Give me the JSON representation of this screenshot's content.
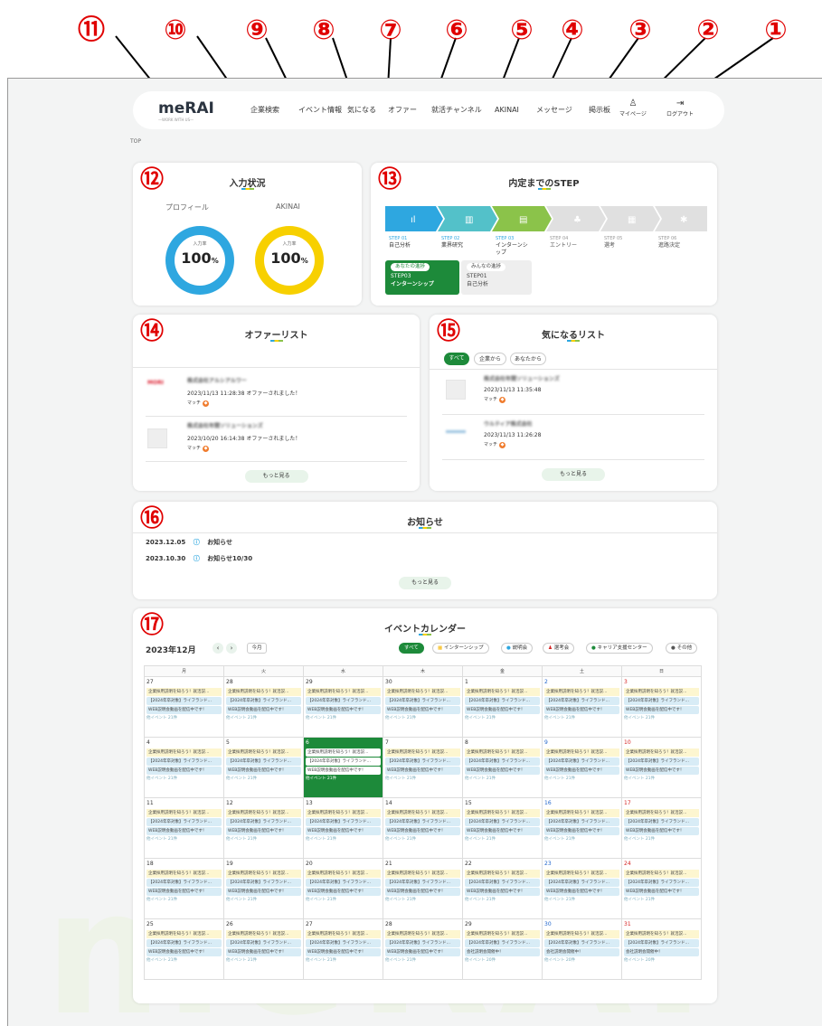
{
  "annotations": [
    "⑪",
    "⑩",
    "⑨",
    "⑧",
    "⑦",
    "⑥",
    "⑤",
    "④",
    "③",
    "②",
    "①",
    "⑫",
    "⑬",
    "⑭",
    "⑮",
    "⑯",
    "⑰"
  ],
  "header": {
    "logo": "meRAI",
    "logo_sub": "—WORK WITH US—",
    "nav": [
      "企業検索",
      "イベント情報",
      "気になる",
      "オファー",
      "就活チャンネル",
      "AKINAI",
      "メッセージ",
      "掲示板"
    ],
    "mypage": "マイページ",
    "logout": "ログアウト"
  },
  "breadcrumb": "TOP",
  "input_status": {
    "title": "入力状況",
    "items": [
      {
        "label": "プロフィール",
        "rate_label": "入力率",
        "value": "100",
        "unit": "%",
        "color": "#2ea7e0",
        "percent": 100
      },
      {
        "label": "AKINAI",
        "rate_label": "入力率",
        "value": "100",
        "unit": "%",
        "color": "#f7d000",
        "percent": 100
      }
    ]
  },
  "steps": {
    "title": "内定までのSTEP",
    "items": [
      {
        "no": "STEP 01",
        "label": "自己分析"
      },
      {
        "no": "STEP 02",
        "label": "業界研究"
      },
      {
        "no": "STEP 03",
        "label": "インターンシップ"
      },
      {
        "no": "STEP 04",
        "label": "エントリー"
      },
      {
        "no": "STEP 05",
        "label": "選考"
      },
      {
        "no": "STEP 06",
        "label": "進路決定"
      }
    ],
    "mine": {
      "tag": "あなたの進捗",
      "step": "STEP03",
      "label": "インターンシップ"
    },
    "everyone": {
      "tag": "みんなの進捗",
      "step": "STEP01",
      "label": "自己分析"
    }
  },
  "offers": {
    "title": "オファーリスト",
    "items": [
      {
        "company": "株式会社アルシアルワー",
        "date": "2023/11/13 11:28:38 オファーされました！",
        "match": "マッチ"
      },
      {
        "company": "株式会社年間ソリューションズ",
        "date": "2023/10/20 16:14:38 オファーされました！",
        "match": "マッチ"
      }
    ],
    "more": "もっと見る",
    "no_image": "NO IMAGE"
  },
  "favorites": {
    "title": "気になるリスト",
    "tabs": [
      "すべて",
      "企業から",
      "あなたから"
    ],
    "items": [
      {
        "company": "株式会社年間ソリューションズ",
        "date": "2023/11/13 11:35:48",
        "match": "マッチ"
      },
      {
        "company": "ウルティア株式会社",
        "date": "2023/11/13 11:26:28",
        "match": "マッチ"
      }
    ],
    "more": "もっと見る"
  },
  "news": {
    "title": "お知らせ",
    "items": [
      {
        "date": "2023.12.05",
        "text": "お知らせ"
      },
      {
        "date": "2023.10.30",
        "text": "お知らせ10/30"
      }
    ],
    "more": "もっと見る"
  },
  "calendar": {
    "title": "イベントカレンダー",
    "month": "2023年12月",
    "today_btn": "今月",
    "filters": [
      "すべて",
      "インターンシップ",
      "説明会",
      "選考会",
      "キャリア支援センター",
      "その他"
    ],
    "weekdays": [
      "月",
      "火",
      "水",
      "木",
      "金",
      "土",
      "日"
    ],
    "event1": "企業採用説明を知ろう！就活説…",
    "event2": "【2024年卒対象】ライフランド…",
    "event3": "WEB説明会動画を配信中です！",
    "event3_alt": "会社説明会開催中！",
    "more_text": "他イベント 21件",
    "more_text_alt": "他イベント 20件",
    "weeks": [
      [
        "27",
        "28",
        "29",
        "30",
        "1",
        "2",
        "3"
      ],
      [
        "4",
        "5",
        "6",
        "7",
        "8",
        "9",
        "10"
      ],
      [
        "11",
        "12",
        "13",
        "14",
        "15",
        "16",
        "17"
      ],
      [
        "18",
        "19",
        "20",
        "21",
        "22",
        "23",
        "24"
      ],
      [
        "25",
        "26",
        "27",
        "28",
        "29",
        "30",
        "31"
      ]
    ]
  },
  "colors": {
    "green": "#1d8a3a",
    "blue": "#2ea7e0",
    "yellow": "#f7d000",
    "annotation": "#e00000"
  }
}
